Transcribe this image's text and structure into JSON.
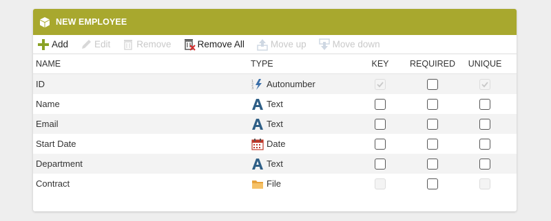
{
  "panel": {
    "title": "NEW EMPLOYEE",
    "accent": "#a8a82e"
  },
  "toolbar": {
    "add": "Add",
    "edit": "Edit",
    "remove": "Remove",
    "remove_all": "Remove All",
    "move_up": "Move up",
    "move_down": "Move down"
  },
  "columns": {
    "name": "NAME",
    "type": "TYPE",
    "key": "KEY",
    "required": "REQUIRED",
    "unique": "UNIQUE"
  },
  "rows": [
    {
      "name": "ID",
      "type": "Autonumber",
      "type_icon": "autonumber-icon",
      "key": "checked-disabled",
      "required": "unchecked",
      "unique": "checked-disabled"
    },
    {
      "name": "Name",
      "type": "Text",
      "type_icon": "text-icon",
      "key": "unchecked",
      "required": "unchecked",
      "unique": "unchecked"
    },
    {
      "name": "Email",
      "type": "Text",
      "type_icon": "text-icon",
      "key": "unchecked",
      "required": "unchecked",
      "unique": "unchecked"
    },
    {
      "name": "Start Date",
      "type": "Date",
      "type_icon": "calendar-icon",
      "key": "unchecked",
      "required": "unchecked",
      "unique": "unchecked"
    },
    {
      "name": "Department",
      "type": "Text",
      "type_icon": "text-icon",
      "key": "unchecked",
      "required": "unchecked",
      "unique": "unchecked"
    },
    {
      "name": "Contract",
      "type": "File",
      "type_icon": "folder-icon",
      "key": "disabled",
      "required": "unchecked",
      "unique": "disabled"
    }
  ]
}
